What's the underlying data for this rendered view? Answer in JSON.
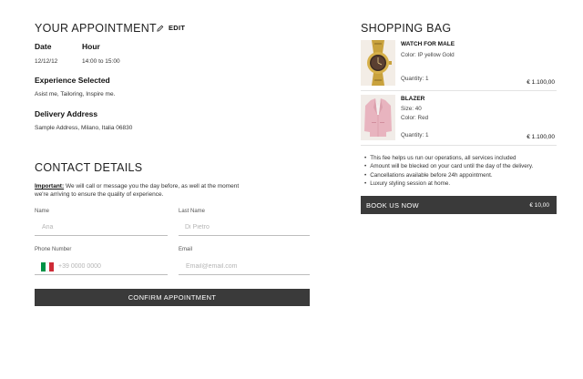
{
  "appointment": {
    "title": "YOUR APPOINTMENT",
    "edit_label": "EDIT",
    "date_label": "Date",
    "date_value": "12/12/12",
    "hour_label": "Hour",
    "hour_value": "14:00 to 15:00",
    "experience_label": "Experience Selected",
    "experience_value": "Asist me, Tailoring, Inspire me.",
    "delivery_label": "Delivery Address",
    "delivery_value": "Sample Address, Milano, Italia 06830"
  },
  "contact": {
    "title": "CONTACT DETAILS",
    "important_label": "Important:",
    "important_text": " We will call or message you the day before, as well at the moment we're arriving to ensure the quality of experience.",
    "name_label": "Name",
    "name_placeholder": "Ana",
    "lastname_label": "Last Name",
    "lastname_placeholder": "Di Pietro",
    "phone_label": "Phone Number",
    "phone_placeholder": "+39 0000 0000",
    "email_label": "Email",
    "email_placeholder": "Email@email.com",
    "confirm_label": "CONFIRM APPOINTMENT"
  },
  "bag": {
    "title": "SHOPPING BAG",
    "items": [
      {
        "name": "WATCH FOR MALE",
        "color": "Color: IP yellow Gold",
        "quantity": "Quantity: 1",
        "price": "€ 1.100,00"
      },
      {
        "name": "BLAZER",
        "size": "Size: 40",
        "color": "Color: Red",
        "quantity": "Quantity: 1",
        "price": "€ 1.100,00"
      }
    ],
    "notes": [
      "This fee helps us run our operations, all services included",
      "Amount will be blecked on your card until the day of the delivery.",
      "Cancellations available before 24h appointment.",
      "Luxury styling session at home."
    ],
    "book_label": "BOOK US NOW",
    "book_price": "€ 10,00"
  },
  "colors": {
    "button_bg": "#3a3a3a",
    "flag_green": "#009246",
    "flag_white": "#ffffff",
    "flag_red": "#ce2b37"
  }
}
